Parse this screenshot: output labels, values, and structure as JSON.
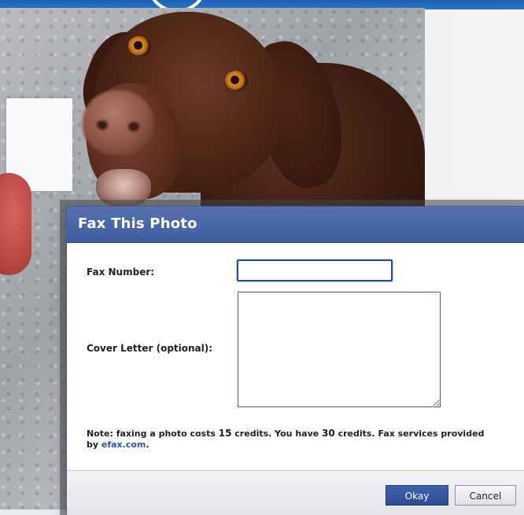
{
  "dialog": {
    "title": "Fax This Photo",
    "fax_number_label": "Fax Number:",
    "fax_number_value": "",
    "cover_letter_label": "Cover Letter (optional):",
    "cover_letter_value": "",
    "note": {
      "prefix": "Note: faxing a photo costs ",
      "cost": "15",
      "middle": " credits. You have ",
      "balance": "30",
      "suffix": " credits. Fax services provided by ",
      "provider_link": "efax.com",
      "end": "."
    },
    "buttons": {
      "okay": "Okay",
      "cancel": "Cancel"
    }
  },
  "colors": {
    "title_bar": "#4a66a6",
    "okay_button": "#2f5199",
    "link": "#2f55a8"
  },
  "background": {
    "image": "photo of a chocolate labrador dog"
  }
}
